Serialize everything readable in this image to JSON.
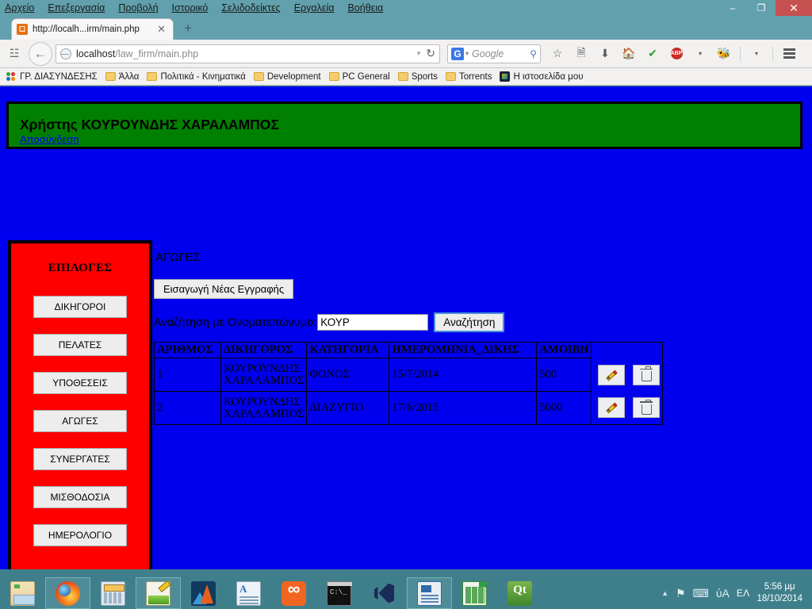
{
  "browser": {
    "menu_items": [
      {
        "label": "Αρχείο",
        "accel": "Α"
      },
      {
        "label": "Επεξεργασία",
        "accel": "Ε"
      },
      {
        "label": "Προβολή",
        "accel": "ο"
      },
      {
        "label": "Ιστορικό",
        "accel": "Ι"
      },
      {
        "label": "Σελιδοδείκτες",
        "accel": "Σ"
      },
      {
        "label": "Εργαλεία",
        "accel": "γ"
      },
      {
        "label": "Βοήθεια",
        "accel": "Β"
      }
    ],
    "window_controls": {
      "minimize": "–",
      "maximize": "❐",
      "close": "✕"
    },
    "tab": {
      "title": "http://localh...irm/main.php",
      "favicon": "xampp-favicon",
      "close_label": "✕",
      "newtab_label": "+"
    },
    "toolbar": {
      "rss_icon": "☳",
      "back_label": "←",
      "url_host": "localhost",
      "url_path": "/law_firm/main.php",
      "url_dropdown": "▾",
      "reload_label": "↻",
      "search_engine": "G",
      "search_caret": "▾",
      "search_placeholder": "Google",
      "search_mag": "⚲",
      "icons": [
        {
          "name": "bookmark-star-icon",
          "glyph": "☆"
        },
        {
          "name": "reading-list-icon",
          "glyph": "ὖE"
        },
        {
          "name": "downloads-icon",
          "glyph": "⬇"
        },
        {
          "name": "home-icon",
          "glyph": "⌂"
        },
        {
          "name": "checkmark-icon",
          "glyph": "✔"
        }
      ],
      "abp_label": "ABP",
      "abp_caret": "▾",
      "addon_caret": "▾",
      "menu_label": "menu"
    },
    "bookmarks": [
      {
        "label": "ΓΡ. ΔΙΑΣΥΝΔΕΣΗΣ",
        "icon": "colors-icon"
      },
      {
        "label": "Άλλα",
        "icon": "folder-icon"
      },
      {
        "label": "Πολιτικά - Κινηματικά",
        "icon": "folder-icon"
      },
      {
        "label": "Development",
        "icon": "folder-icon"
      },
      {
        "label": "PC General",
        "icon": "folder-icon"
      },
      {
        "label": "Sports",
        "icon": "folder-icon"
      },
      {
        "label": "Torrents",
        "icon": "folder-icon"
      },
      {
        "label": "Η ιστοσελίδα μου",
        "icon": "joomla-icon"
      }
    ]
  },
  "page": {
    "header": {
      "user_label": "Χρήστης ΚΟΥΡΟΥΝΔΗΣ ΧΑΡΑΛΑΜΠΟΣ",
      "logout_label": "Αποσύνδεση"
    },
    "sidebar": {
      "heading": "ΕΠΙΛΟΓΕΣ",
      "items": [
        {
          "label": "ΔΙΚΗΓΟΡΟΙ"
        },
        {
          "label": "ΠΕΛΑΤΕΣ"
        },
        {
          "label": "ΥΠΟΘΕΣΕΙΣ"
        },
        {
          "label": "ΑΓΩΓΕΣ"
        },
        {
          "label": "ΣΥΝΕΡΓΑΤΕΣ"
        },
        {
          "label": "ΜΙΣΘΟΔΟΣΙΑ"
        },
        {
          "label": "ΗΜΕΡΟΛΟΓΙΟ"
        }
      ]
    },
    "content": {
      "title": "ΑΓΩΓΕΣ",
      "new_record_button": "Εισαγωγή Νέας Εγγραφής",
      "search_label": "Αναζήτηση με Ονοματεπώνυμο:",
      "search_value": "ΚΟΥΡ",
      "search_button": "Αναζήτηση",
      "table": {
        "columns": [
          "ΑΡΙΘΜΟΣ",
          "ΔΙΚΗΓΟΡΟΣ",
          "ΚΑΤΗΓΟΡΙΑ",
          "ΗΜΕΡΟΜΗΝΙΑ_ΔΙΚΗΣ",
          "ΑΜΟΙΒΗ"
        ],
        "rows": [
          {
            "arithmos": "1",
            "dikigoros": "ΚΟΥΡΟΥΝΔΗΣ ΧΑΡΑΛΑΜΠΟΣ",
            "katigoria": "ΦΟΝΟΣ",
            "imerominia": "15/7/2014",
            "amoivi": "500"
          },
          {
            "arithmos": "2",
            "dikigoros": "ΚΟΥΡΟΥΝΔΗΣ ΧΑΡΑΛΑΜΠΟΣ",
            "katigoria": "ΔΙΑΖΥΓΙΟ",
            "imerominia": "17/6/2015",
            "amoivi": "5000"
          }
        ],
        "action_icons": {
          "edit": "pencil-icon",
          "delete": "trash-icon"
        }
      }
    },
    "colors": {
      "page_background": "#0000ee",
      "header_background": "#008000",
      "sidebar_background": "#ff0000",
      "link": "#0000ee"
    }
  },
  "taskbar": {
    "apps": [
      {
        "name": "file-explorer",
        "active": false
      },
      {
        "name": "firefox",
        "active": true
      },
      {
        "name": "calculator",
        "active": false
      },
      {
        "name": "notepad-plus-plus",
        "active": true
      },
      {
        "name": "matlab",
        "active": false
      },
      {
        "name": "wordpad",
        "active": false
      },
      {
        "name": "xampp",
        "active": false
      },
      {
        "name": "command-prompt",
        "active": false
      },
      {
        "name": "visual-studio",
        "active": false
      },
      {
        "name": "libreoffice-writer",
        "active": true
      },
      {
        "name": "libreoffice-calc",
        "active": false
      },
      {
        "name": "qt-creator",
        "active": false
      }
    ],
    "tray": {
      "show_hidden": "▲",
      "flag_icon": "⚑",
      "network_icon": "⌨",
      "volume_icon": "ὐA",
      "language": "ΕΛ",
      "time": "5:56 μμ",
      "date": "18/10/2014"
    }
  }
}
